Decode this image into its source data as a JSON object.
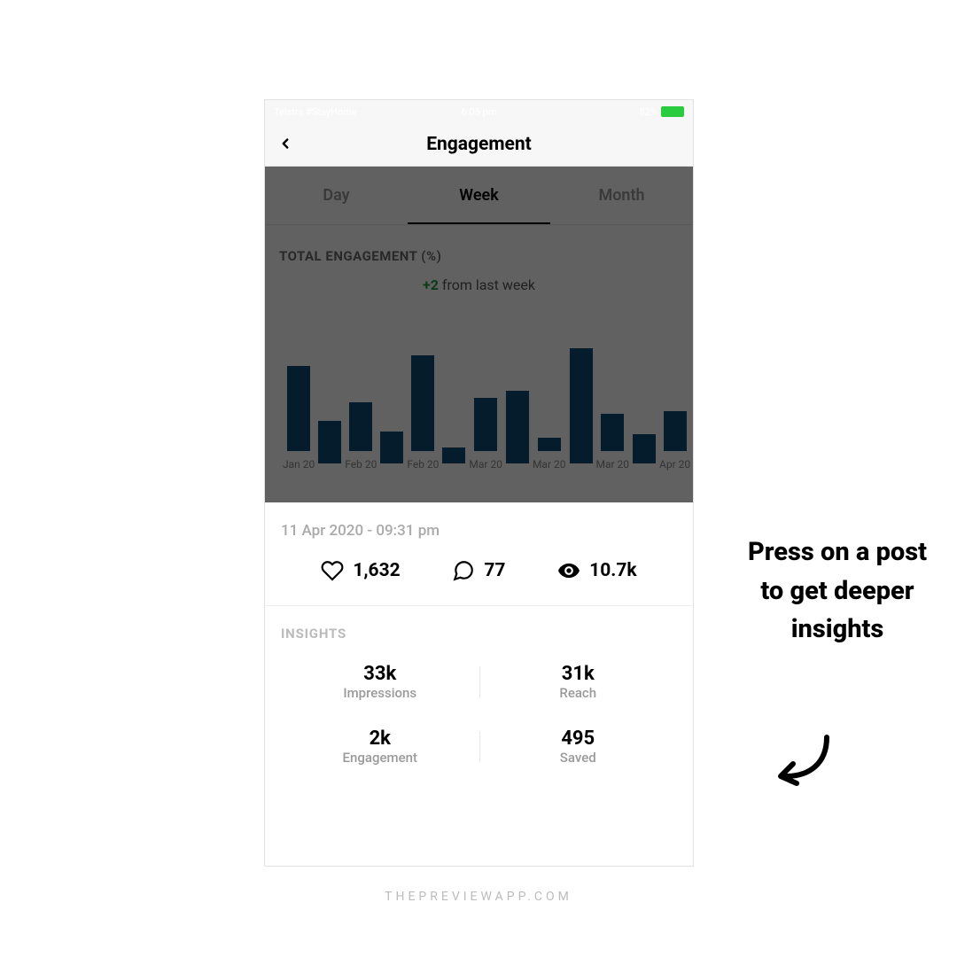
{
  "status_bar": {
    "carrier": "Telstra #StayHome",
    "time": "6:05 pm",
    "battery_pct": "82%"
  },
  "nav": {
    "title": "Engagement"
  },
  "tabs": {
    "day": "Day",
    "week": "Week",
    "month": "Month"
  },
  "chart": {
    "title": "TOTAL ENGAGEMENT (%)",
    "delta_value": "+2",
    "delta_suffix": " from last week"
  },
  "chart_data": {
    "type": "bar",
    "categories": [
      "Jan 20",
      "",
      "Feb 20",
      "",
      "Feb 20",
      "",
      "Mar 20",
      "",
      "Mar 20",
      "",
      "Mar 20",
      "",
      "Apr 20"
    ],
    "values": [
      64,
      32,
      37,
      24,
      72,
      12,
      40,
      55,
      10,
      87,
      28,
      22,
      30
    ],
    "title": "TOTAL ENGAGEMENT (%)",
    "xlabel": "",
    "ylabel": "",
    "ylim": [
      0,
      100
    ]
  },
  "post": {
    "date": "11 Apr 2020 - 09:31 pm",
    "likes": "1,632",
    "comments": "77",
    "views": "10.7k"
  },
  "insights": {
    "title": "INSIGHTS",
    "cells": [
      {
        "value": "33k",
        "label": "Impressions"
      },
      {
        "value": "31k",
        "label": "Reach"
      },
      {
        "value": "2k",
        "label": "Engagement"
      },
      {
        "value": "495",
        "label": "Saved"
      }
    ]
  },
  "callout": "Press on a post to get deeper insights",
  "footer": "THEPREVIEWAPP.COM"
}
